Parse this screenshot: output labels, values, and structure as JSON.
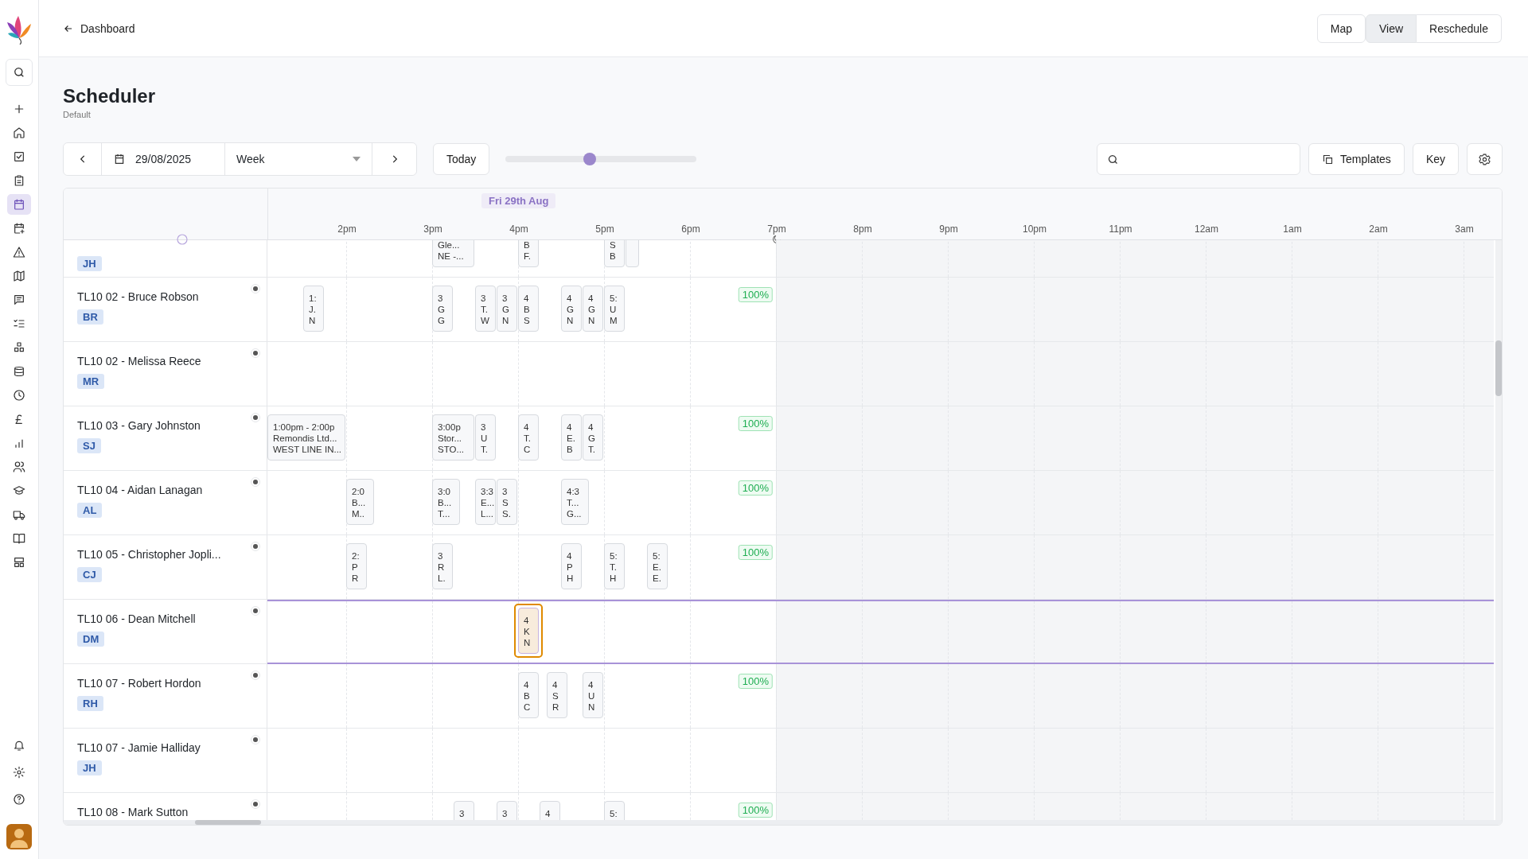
{
  "topbar": {
    "back_label": "Dashboard",
    "buttons": [
      {
        "label": "Map",
        "selected": false
      },
      {
        "label": "View",
        "selected": true
      },
      {
        "label": "Reschedule",
        "selected": false
      }
    ]
  },
  "nav_items": [
    {
      "selected": false
    },
    {
      "selected": false
    },
    {
      "selected": false
    },
    {
      "selected": false
    },
    {
      "selected": true
    },
    {
      "selected": false
    },
    {
      "selected": false
    },
    {
      "selected": false
    },
    {
      "selected": false
    },
    {
      "selected": false
    },
    {
      "selected": false
    },
    {
      "selected": false
    },
    {
      "selected": false
    },
    {
      "selected": false
    },
    {
      "selected": false
    },
    {
      "selected": false
    },
    {
      "selected": false
    },
    {
      "selected": false
    },
    {
      "selected": false
    },
    {
      "selected": false
    }
  ],
  "page": {
    "title": "Scheduler",
    "subtitle": "Default"
  },
  "toolbar": {
    "date": "29/08/2025",
    "view": "Week",
    "today": "Today",
    "zoom": {
      "level": 0.44
    },
    "templates": "Templates",
    "key": "Key"
  },
  "timeline": {
    "date_label": "Fri 29th Aug",
    "hours": [
      "2pm",
      "3pm",
      "4pm",
      "5pm",
      "6pm",
      "7pm",
      "8pm",
      "9pm",
      "10pm",
      "11pm",
      "12am",
      "1am",
      "2am",
      "3am"
    ]
  },
  "rows": [
    {
      "initials": "JH",
      "selected": false,
      "jobs": [
        {
          "lines": [
            "Gle...",
            "NE -..."
          ],
          "selected": false
        },
        {
          "lines": [
            "B",
            "F."
          ],
          "selected": false
        },
        {
          "lines": [
            "S",
            "B"
          ],
          "selected": false
        },
        {
          "selected": false
        }
      ]
    },
    {
      "name": "TL10 02 - Bruce Robson",
      "initials": "BR",
      "utilisation": "100%",
      "selected": false,
      "jobs": [
        {
          "lines": [
            "1:",
            "J.",
            "N"
          ],
          "selected": false
        },
        {
          "lines": [
            "3",
            "G",
            "G"
          ],
          "selected": false
        },
        {
          "lines": [
            "3",
            "T.",
            "W"
          ],
          "selected": false
        },
        {
          "lines": [
            "3",
            "G",
            "N"
          ],
          "selected": false
        },
        {
          "lines": [
            "4",
            "B",
            "S"
          ],
          "selected": false
        },
        {
          "lines": [
            "4",
            "G",
            "N"
          ],
          "selected": false
        },
        {
          "lines": [
            "4",
            "G",
            "N"
          ],
          "selected": false
        },
        {
          "lines": [
            "5:",
            "U",
            "M"
          ],
          "selected": false
        }
      ]
    },
    {
      "name": "TL10 02 - Melissa Reece",
      "initials": "MR",
      "selected": false
    },
    {
      "name": "TL10 03 - Gary Johnston",
      "initials": "SJ",
      "utilisation": "100%",
      "selected": false,
      "jobs": [
        {
          "lines": [
            "1:00pm - 2:00p",
            "Remondis Ltd...",
            "WEST LINE IN..."
          ],
          "selected": false
        },
        {
          "lines": [
            "3:00p",
            "Stor...",
            "STO..."
          ],
          "selected": false
        },
        {
          "lines": [
            "3",
            "U",
            "T."
          ],
          "selected": false
        },
        {
          "lines": [
            "4",
            "T.",
            "C"
          ],
          "selected": false
        },
        {
          "lines": [
            "4",
            "E.",
            "B"
          ],
          "selected": false
        },
        {
          "lines": [
            "4",
            "G",
            "T."
          ],
          "selected": false
        }
      ]
    },
    {
      "name": "TL10 04 - Aidan Lanagan",
      "initials": "AL",
      "utilisation": "100%",
      "selected": false,
      "jobs": [
        {
          "lines": [
            "2:0",
            "B...",
            "M.."
          ],
          "selected": false
        },
        {
          "lines": [
            "3:0",
            "B...",
            "T..."
          ],
          "selected": false
        },
        {
          "lines": [
            "3:3",
            "E...",
            "L..."
          ],
          "selected": false
        },
        {
          "lines": [
            "3",
            "S",
            "S."
          ],
          "selected": false
        },
        {
          "lines": [
            "4:3",
            "T...",
            "G..."
          ],
          "selected": false
        }
      ]
    },
    {
      "name": "TL10 05 - Christopher Jopli...",
      "initials": "CJ",
      "utilisation": "100%",
      "selected": false,
      "jobs": [
        {
          "lines": [
            "2:",
            "P",
            "R"
          ],
          "selected": false
        },
        {
          "lines": [
            "3",
            "R",
            "L."
          ],
          "selected": false
        },
        {
          "lines": [
            "4",
            "P",
            "H"
          ],
          "selected": false
        },
        {
          "lines": [
            "5:",
            "T.",
            "H"
          ],
          "selected": false
        },
        {
          "lines": [
            "5:",
            "E.",
            "E."
          ],
          "selected": false
        }
      ]
    },
    {
      "name": "TL10 06 - Dean Mitchell",
      "initials": "DM",
      "selected": true,
      "jobs": [
        {
          "lines": [
            "4",
            "K",
            "N"
          ],
          "selected": true
        }
      ]
    },
    {
      "name": "TL10 07 - Robert Hordon",
      "initials": "RH",
      "utilisation": "100%",
      "selected": false,
      "jobs": [
        {
          "lines": [
            "4",
            "B",
            "C"
          ],
          "selected": false
        },
        {
          "lines": [
            "4",
            "S",
            "R"
          ],
          "selected": false
        },
        {
          "lines": [
            "4",
            "U",
            "N"
          ],
          "selected": false
        }
      ]
    },
    {
      "name": "TL10 07 - Jamie Halliday",
      "initials": "JH",
      "selected": false
    },
    {
      "name": "TL10 08 - Mark Sutton",
      "utilisation": "100%",
      "selected": false,
      "jobs": [
        {
          "lines": [
            "3"
          ],
          "selected": false
        },
        {
          "lines": [
            "3"
          ],
          "selected": false
        },
        {
          "lines": [
            "4"
          ],
          "selected": false
        },
        {
          "lines": [
            "5:"
          ],
          "selected": false
        }
      ]
    }
  ]
}
